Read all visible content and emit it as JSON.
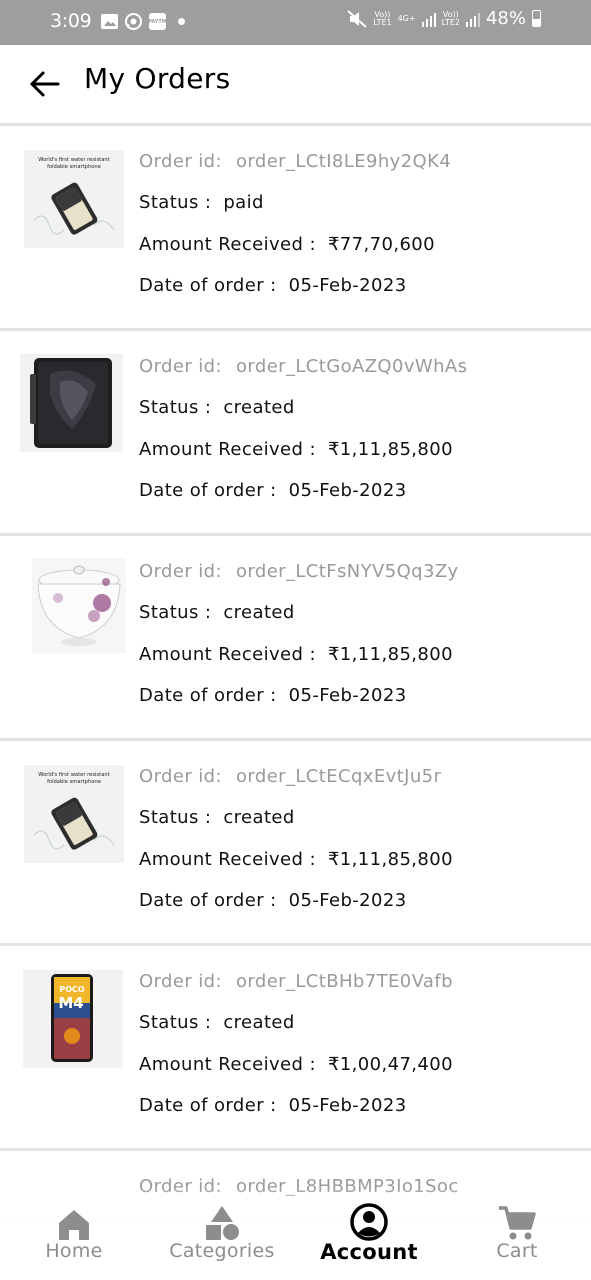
{
  "status_bar": {
    "time": "3:09",
    "app_icon_label": "PAYTM",
    "network1": "Vo))\nLTE1",
    "network_type": "4G+",
    "network2": "Vo))\nLTE2",
    "battery_percent": "48%"
  },
  "header": {
    "title": "My Orders",
    "back_icon": "arrow-left-icon"
  },
  "labels": {
    "order_id": "Order id:",
    "status": "Status :",
    "amount": "Amount Received :",
    "date": "Date of order :"
  },
  "orders": [
    {
      "order_id": "order_LCtI8LE9hy2QK4",
      "status": "paid",
      "amount": "₹77,70,600",
      "date": "05-Feb-2023",
      "image": "foldable-phone-image",
      "image_caption": "World's first water resistant foldable smartphone"
    },
    {
      "order_id": "order_LCtGoAZQ0vWhAs",
      "status": "created",
      "amount": "₹1,11,85,800",
      "date": "05-Feb-2023",
      "image": "tablet-image"
    },
    {
      "order_id": "order_LCtFsNYV5Qq3Zy",
      "status": "created",
      "amount": "₹1,11,85,800",
      "date": "05-Feb-2023",
      "image": "ceramic-bowl-image"
    },
    {
      "order_id": "order_LCtECqxEvtJu5r",
      "status": "created",
      "amount": "₹1,11,85,800",
      "date": "05-Feb-2023",
      "image": "foldable-phone-image",
      "image_caption": "World's first water resistant foldable smartphone"
    },
    {
      "order_id": "order_LCtBHb7TE0Vafb",
      "status": "created",
      "amount": "₹1,00,47,400",
      "date": "05-Feb-2023",
      "image": "poco-phone-image",
      "image_caption": "POCO M4 5G"
    },
    {
      "order_id": "order_L8HBBMP3Io1Soc"
    }
  ],
  "bottom_nav": [
    {
      "label": "Home",
      "icon": "home-icon"
    },
    {
      "label": "Categories",
      "icon": "categories-icon"
    },
    {
      "label": "Account",
      "icon": "account-icon",
      "active": true
    },
    {
      "label": "Cart",
      "icon": "cart-icon"
    }
  ],
  "colors": {
    "status_bar_bg": "#9e9e9e",
    "divider": "#e3e3e3",
    "muted_text": "#9a9a9a",
    "active_nav": "#000000",
    "inactive_nav": "#8d8d8d"
  }
}
